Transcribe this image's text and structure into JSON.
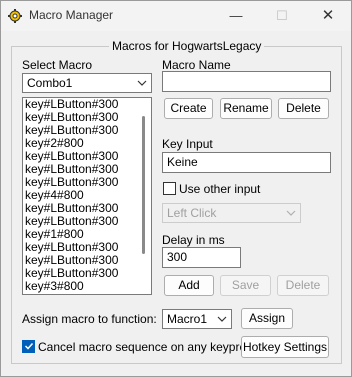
{
  "window": {
    "title": "Macro Manager",
    "minimize_glyph": "—",
    "maximize_glyph": "☐",
    "close_glyph": "✕"
  },
  "group": {
    "title": "Macros for HogwartsLegacy"
  },
  "select_macro": {
    "label": "Select Macro",
    "value": "Combo1"
  },
  "macro_list": [
    "key#LButton#300",
    "key#LButton#300",
    "key#LButton#300",
    "key#2#800",
    "key#LButton#300",
    "key#LButton#300",
    "key#LButton#300",
    "key#4#800",
    "key#LButton#300",
    "key#LButton#300",
    "key#1#800",
    "key#LButton#300",
    "key#LButton#300",
    "key#LButton#300",
    "key#3#800"
  ],
  "macro_name": {
    "label": "Macro Name",
    "value": ""
  },
  "actions": {
    "create": "Create",
    "rename": "Rename",
    "delete": "Delete"
  },
  "key_input": {
    "label": "Key Input",
    "value": "Keine"
  },
  "use_other_input": {
    "label": "Use other input",
    "checked": false
  },
  "other_input": {
    "value": "Left Click"
  },
  "delay": {
    "label": "Delay in ms",
    "value": "300"
  },
  "step_actions": {
    "add": "Add",
    "save": "Save",
    "delete": "Delete"
  },
  "assign": {
    "label": "Assign macro to function:",
    "function_value": "Macro1",
    "button": "Assign"
  },
  "cancel_on_keypress": {
    "label": "Cancel macro sequence on any keypress.",
    "checked": true
  },
  "hotkey_settings": "Hotkey Settings",
  "colors": {
    "accent": "#005fb8",
    "window_bg": "#f0f0f0",
    "disabled_text": "#a0a0a0"
  },
  "icons": {
    "app": "gear-icon",
    "dropdown": "chevron-down-icon",
    "check": "checkmark-icon"
  }
}
